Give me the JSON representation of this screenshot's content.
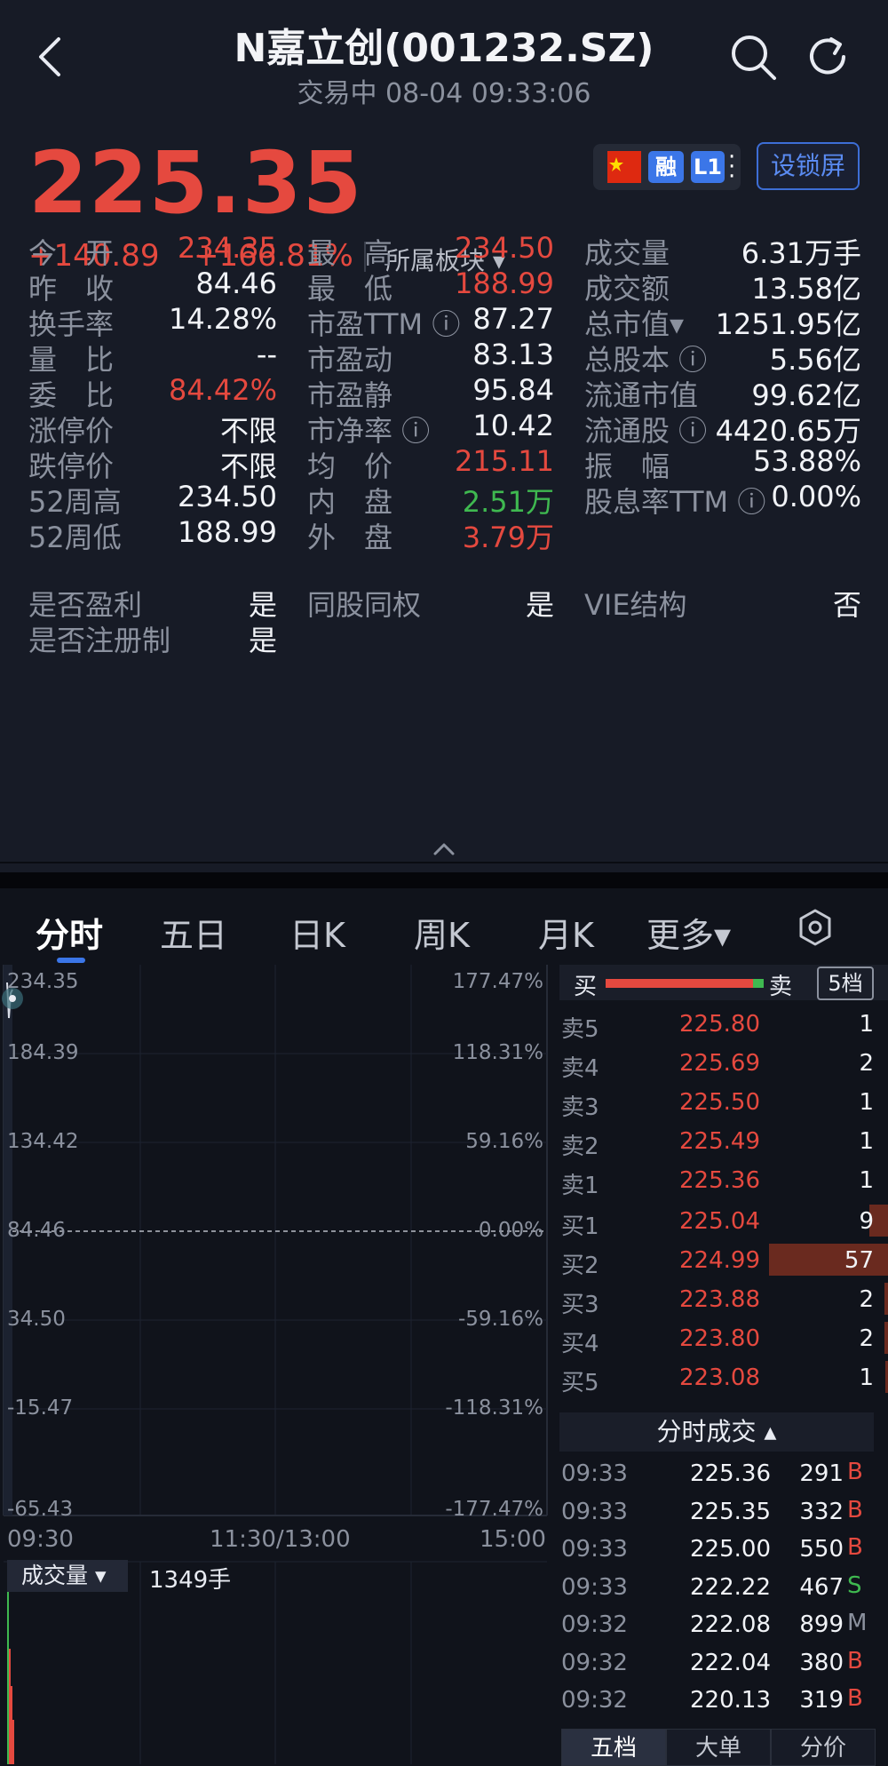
{
  "header": {
    "title": "N嘉立创(001232.SZ)",
    "subtitle": "交易中 08-04 09:33:06"
  },
  "quote": {
    "price": "225.35",
    "change_abs": "+140.89",
    "change_pct": "+166.81%",
    "sector": "所属板块 ▾",
    "badge_rong": "融",
    "badge_l1": "L1",
    "lock_button": "设锁屏",
    "stats": [
      {
        "l1": "今　开",
        "v1": "234.35",
        "c1": "red",
        "l2": "最　高",
        "v2": "234.50",
        "c2": "red",
        "l3": "成交量",
        "v3": "6.31万手",
        "c3": "white"
      },
      {
        "l1": "昨　收",
        "v1": "84.46",
        "c1": "white",
        "l2": "最　低",
        "v2": "188.99",
        "c2": "red",
        "l3": "成交额",
        "v3": "13.58亿",
        "c3": "white"
      },
      {
        "l1": "换手率",
        "v1": "14.28%",
        "c1": "white",
        "l2": "市盈TTM ⓘ",
        "v2": "87.27",
        "c2": "white",
        "l3": "总市值▾",
        "v3": "1251.95亿",
        "c3": "white"
      },
      {
        "l1": "量　比",
        "v1": "--",
        "c1": "white",
        "l2": "市盈动",
        "v2": "83.13",
        "c2": "white",
        "l3": "总股本 ⓘ",
        "v3": "5.56亿",
        "c3": "white"
      },
      {
        "l1": "委　比",
        "v1": "84.42%",
        "c1": "red",
        "l2": "市盈静",
        "v2": "95.84",
        "c2": "white",
        "l3": "流通市值",
        "v3": "99.62亿",
        "c3": "white"
      },
      {
        "l1": "涨停价",
        "v1": "不限",
        "c1": "white",
        "l2": "市净率 ⓘ",
        "v2": "10.42",
        "c2": "white",
        "l3": "流通股 ⓘ",
        "v3": "4420.65万",
        "c3": "white"
      },
      {
        "l1": "跌停价",
        "v1": "不限",
        "c1": "white",
        "l2": "均　价",
        "v2": "215.11",
        "c2": "red",
        "l3": "振　幅",
        "v3": "53.88%",
        "c3": "white"
      },
      {
        "l1": "52周高",
        "v1": "234.50",
        "c1": "white",
        "l2": "内　盘",
        "v2": "2.51万",
        "c2": "green",
        "l3": "股息率TTM ⓘ",
        "v3": "0.00%",
        "c3": "white"
      },
      {
        "l1": "52周低",
        "v1": "188.99",
        "c1": "white",
        "l2": "外　盘",
        "v2": "3.79万",
        "c2": "red",
        "l3": "",
        "v3": "",
        "c3": "white"
      }
    ],
    "info": [
      {
        "l1": "是否盈利",
        "v1": "是",
        "l2": "同股同权",
        "v2": "是",
        "l3": "VIE结构",
        "v3": "否"
      },
      {
        "l1": "是否注册制",
        "v1": "是",
        "l2": "",
        "v2": "",
        "l3": "",
        "v3": ""
      }
    ]
  },
  "tabs": [
    "分时",
    "五日",
    "日K",
    "周K",
    "月K",
    "更多▾"
  ],
  "chart": {
    "left_axis": [
      "234.35",
      "184.39",
      "134.42",
      "84.46",
      "34.50",
      "-15.47",
      "-65.43"
    ],
    "right_axis": [
      "177.47%",
      "118.31%",
      "59.16%",
      "0.00%",
      "-59.16%",
      "-118.31%",
      "-177.47%"
    ],
    "time_axis": [
      "09:30",
      "11:30/13:00",
      "15:00"
    ],
    "volume_label": "成交量 ▾",
    "volume_value": "1349手"
  },
  "order_book": {
    "buy_label": "买",
    "sell_label": "卖",
    "depth_label": "5档",
    "buy_ratio": 0.93,
    "asks": [
      {
        "label": "卖5",
        "price": "225.80",
        "qty": "1"
      },
      {
        "label": "卖4",
        "price": "225.69",
        "qty": "2"
      },
      {
        "label": "卖3",
        "price": "225.50",
        "qty": "1"
      },
      {
        "label": "卖2",
        "price": "225.49",
        "qty": "1"
      },
      {
        "label": "卖1",
        "price": "225.36",
        "qty": "1"
      }
    ],
    "bids": [
      {
        "label": "买1",
        "price": "225.04",
        "qty": "9",
        "bar": 0.16
      },
      {
        "label": "买2",
        "price": "224.99",
        "qty": "57",
        "bar": 1.0
      },
      {
        "label": "买3",
        "price": "223.88",
        "qty": "2",
        "bar": 0.03
      },
      {
        "label": "买4",
        "price": "223.80",
        "qty": "2",
        "bar": 0.03
      },
      {
        "label": "买5",
        "price": "223.08",
        "qty": "1",
        "bar": 0.02
      }
    ]
  },
  "ticks": {
    "header": "分时成交 ▴",
    "rows": [
      {
        "time": "09:33",
        "price": "225.36",
        "vol": "291",
        "flag": "B"
      },
      {
        "time": "09:33",
        "price": "225.35",
        "vol": "332",
        "flag": "B"
      },
      {
        "time": "09:33",
        "price": "225.00",
        "vol": "550",
        "flag": "B"
      },
      {
        "time": "09:33",
        "price": "222.22",
        "vol": "467",
        "flag": "S"
      },
      {
        "time": "09:32",
        "price": "222.08",
        "vol": "899",
        "flag": "M"
      },
      {
        "time": "09:32",
        "price": "222.04",
        "vol": "380",
        "flag": "B"
      },
      {
        "time": "09:32",
        "price": "220.13",
        "vol": "319",
        "flag": "B"
      }
    ]
  },
  "bottom_tabs": [
    "五档",
    "大单",
    "分价"
  ],
  "colors": {
    "up": "#e5493f",
    "down": "#3fb950",
    "accent": "#3b76e8",
    "bg": "#10131b"
  }
}
